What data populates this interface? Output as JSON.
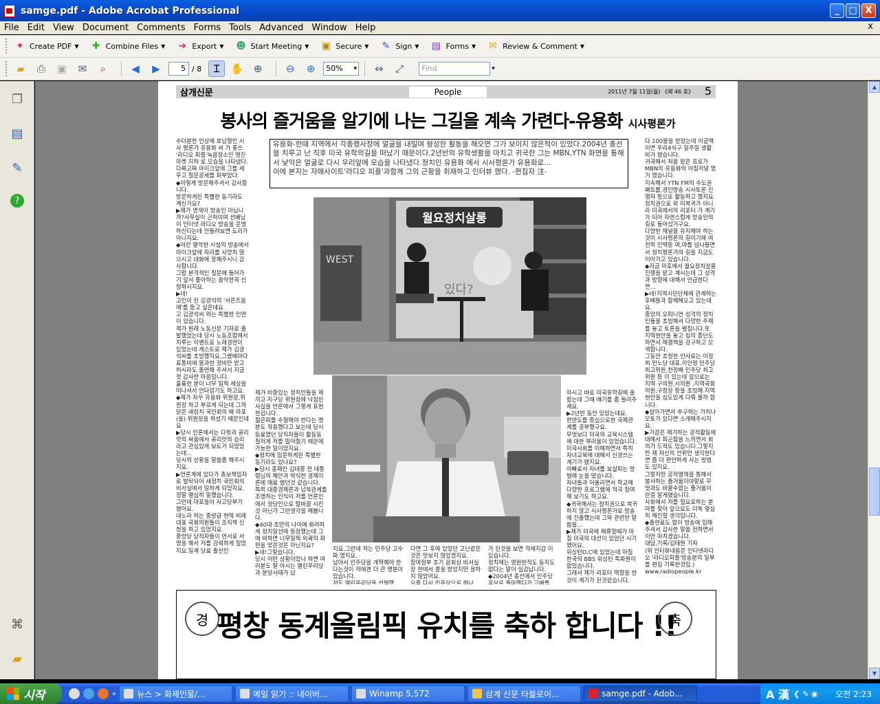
{
  "window": {
    "title": "samge.pdf - Adobe Acrobat Professional",
    "min": "_",
    "max": "□",
    "close": "X"
  },
  "menu": [
    "File",
    "Edit",
    "View",
    "Document",
    "Comments",
    "Forms",
    "Tools",
    "Advanced",
    "Window",
    "Help"
  ],
  "menu_close": "x",
  "toolbar1": [
    {
      "label": "Create PDF",
      "icon": "create-pdf-icon",
      "glyph": "✦",
      "color": "#d33"
    },
    {
      "label": "Combine Files",
      "icon": "combine-files-icon",
      "glyph": "✚",
      "color": "#3a3"
    },
    {
      "label": "Export",
      "icon": "export-icon",
      "glyph": "➜",
      "color": "#c36"
    },
    {
      "label": "Start Meeting",
      "icon": "start-meeting-icon",
      "glyph": "☻",
      "color": "#4a7"
    },
    {
      "label": "Secure",
      "icon": "lock-icon",
      "glyph": "🔒",
      "color": "#b80"
    },
    {
      "label": "Sign",
      "icon": "pen-sign-icon",
      "glyph": "✎",
      "color": "#36c"
    },
    {
      "label": "Forms",
      "icon": "forms-icon",
      "glyph": "▤",
      "color": "#83c"
    },
    {
      "label": "Review & Comment",
      "icon": "review-comment-icon",
      "glyph": "✉",
      "color": "#da2"
    }
  ],
  "nav": {
    "page_current": "5",
    "page_total": "/ 8",
    "zoom": "50%",
    "find_placeholder": "Find"
  },
  "paper": {
    "name": "삼개신문",
    "section": "People",
    "date": "2011년 7월 11일(월) 《제 46 호》",
    "page_no": "5",
    "headline": "봉사의 즐거움을 알기에 나는 그길을 계속 가련다-유용화",
    "headline_sub": "시사평론가",
    "lead": "유용화-한때 지역에서 각종행사장에 얼굴을 내밀며 왕성한 활동을 해오면 그가 보이지 않은적이 있었다.2004년 총선을 치루고 난 직후 미국 유학의길을 떠났기 때문이다.2년반의 유학생활을 마치고 귀국한 그는 MBN,YTN 화면을 통해서 낯익은 얼굴로 다시 우리앞에 모습을 나타냈다.정치인 유용화 에서 시사평론가 유용화로...",
    "lead2": "이에 본지는 자매사이트'라디오 피플'과함께 그의 근황을 취재하고 인터뷰 했다.          -편집자 注-",
    "col1": "수더분한 인상에 호남형인 시사 평론가 유용화 씨 가 롯쓰 '라디오 피플'녹음장소인 영진마켓 지하 로 모습을 나타냈다.\n다짜고짜 마이크앞에 그를 세우고 질문공세를 퍼부었다.\n◆이렇게 방문해주셔서 감사합니다.\n방문하게된 특별한 동기라도 계신가요?\n▶제가 명색이 방송인 아닙니까?사무실이 근처이며 선배님이 인터넷 라디오 방송을 운영하신다는데 안들려보면 도리가 아니지요.\n◆이런 열악한 시설의 방송에서 마이크앞에 자리를 사양치 않으시고 대화에 응해주시니 감사합니다.\n그럼 본격적인 질문에 들어가기 앞서 좋아하는 음악한곡 신청하시지요.\n▶네!\n고인이 된 김광석의 '서른즈음에'를 듣고 싶은데요.\n고 김광석씨 와는 특별한 인연이 있습니다.\n제가 원래 노동신문 기자로 출발했었는데 당시 노동조합에서 치루는 이벤트로 노래경연이 있었는데 게스트로 제가 김광석씨를 초빙했지요.그랬때마다 표통비에 불과한 경비만 받고 허시라도 출연해 주셔서 지금껏 감사한 마음입니다.\n훌륭한 분이 너무 일찍 세상을 떠나셔서 안타깝기도 하고요.\n◆제가 자꾸 유용화 위원장,위원장 하고 부르게 되는데 그까닭은 새정치 국민회의 때 마포(을) 위원장을 하셨기 때문인데요\n▶당시 인론에서는 다윗과 골리앗의 싸움에서 골리앗의 승리라고 관심있게 보도가 되었었는데...\n당시의 상황을 말씀좀 해주시지요.\n▶언론계에 있다가 총보책임자로 발탁되어 새정치 국민회의 비서실에서 일하게 되었지요.\n정말 열심히 일했습니다.\n그런데 마포을이 사고당부가 됐어요.\n내노라 하는 중량급 현역 비례대표 국회의원들이 조직책 신청을 하고 있었지요.\n중앙당 당직자들이 연서로 서명을 해서 저를 강력하게 밀었지요.일계 당료 출신인",
    "col2": "제가 비중있는 정치인들을 제끼고 지구당 위원장에 낙점된 사실을 언론에서 그렇게 표현 한겁니다.\n젊은피를 수혈해야 한다는 명분도 작용했다고 보는데 당시 동료였던 당직자들이 활동동 철저게 저를 밀어줬기 때문에 가능한 일이었지요.\n◆정치에 입문하게된 특별한 동기라도 있나요?\n▶당시 총재인 김대중 전 대통령님의 혜안과 박식한 경제이론에 매료 됐던것 같습니다.\n특히 대중경제론과 남북관계를 조명하는 인식이 저를 언론인에서 정당인으로 탈바꿈 시킨것 아닌가 그런생각을 해봅니다.\n◆40대 초반의 나이에 화려하게 정치일선에 등장했는데 그에 비하면 너무일찍 외곽의 파편을 맞은것은 아닌지요?\n▶네!그렇습니다.\n당시 어떤 상황이었나 하면 여러분도 잘 아시는 열린우리당과 분당사태가 났",
    "col3": "지요.그런데 저는 민주당 고수파 였지요.\n남아서 민주당을 개혁해야 한다는것이 저에겐 더 큰 명분이었습니다.\n저도 열린우리당을 선택했",
    "col4": "다면 그 후에 있었던 고난같은것은 맛보지 않았겠지요.\n참여정부 초기 윤회상 비서실장 한테서 콜을 받았지만 응하지 않았어요.\n요즘 다시 민주당으로 하나",
    "col5": "가 된것을 보면 격세지감 이 있습니다.\n정치에는 영원한적도 동지도 없다는 말이 실감납니다.\n◆2004년 총선에서 민주당 후보로 출마했다가 고배를",
    "col6": "마시고 바로 미국유학길에 올랐는데 그때 얘기를 좀 들려주세요.\n▶2년반 동안 있었는데요.\n한반도를 중심으로한 국제관계를 공부했구요.\n무엇보다 미국의 교육시스템에 대한 부러움이 있었습니다.\n미국사회를 이해하면서 특히 자녀교육에 대해서 신경쓰는 계기가 됐지요.\n아빠로서 자녀를 보살피는 방법에 눈을 떴습니다.\n자녀들과 어울리면서 학교에 다양한 프로그램에 적극 참여해 보기도 하고요.\n◆귀국해서는 정치권으로 복귀하지 않고 시사평론가로 방송에 진출했는데 그와 관련한 말씀을...\n▶제가 미국에 체류할때가 마침 미국의 대선이 있었던 시기였어요.\n워싱턴D.C에 있었는데 마침 한국의 BBS 워싱턴 특파원이 없었습니다.\n그래서 제가 리포터 역할을 한것이 계기가 된것같습니다.",
    "col7": "다.100불을 받았는데 이금액이면 우리4식구 일주일 생활비가 됐습니다.\n귀국해서 처음 맡은 프로가 MBN의 유용화의 아침저널 였거 였습니다.\n지속해서 YTN FM의 수도권 패트롤,경인방송 시사토론 진행자 등으로 활동하고 했지요.\n정치권으로 외 미복귀가 아니라 미국에서의 리포터 가 계기가 되어 자연스럽게 방송인의 길로 들어섰거구요.\n다양한 채널을 유지해야 하는것이 시사평론의 길이기에 여전히 인맥등 여,야를 넘나들면서 정치평론가의 길을 지금도 이어가고 있습니다.\n◆지금 마포에서 월요정치살롱 진행을 맡고 계시는데 그 성격과 방향에 대해서 언급한다면...\n▶네!지역시민단체에 관계하는 후배들과 함께해오고 있는데요.\n중앙의 오피니언 성격의 정치인들을 초빙해서 다양한 주제를 놓고 토론을 펼칩니다.또 지역현안을 놓고 집의 중단도 하면서 해결책을 강구하고 모색합니다.\n그동안 초청한 인사로는 이정희 민노당 대표,이인영 민주당 최고위원,천정배 민주당 최고위원 등 이 있는데 앞으로는 지역 구의원,시의원 ,지역국회의원,구청장 등을 초빙해 지역현안을 심도있게 다뤄 볼까 합니다.\n◆살아가면서 추구하는 가치나 모토가 있다면 소개해주시지요.\n▶가끔은 제가하는 공적활동에 대해서 피곤함을 느끼면서 회의가 드적도 있습니다.그렇지만 제 자신의 안위만 생각한다면 좀 더 편안하게 사는 방법도 있지요.\n그렇지만 공적영역을 통해서 봉사하는 즐거움이야말로 무엇과도 바꿀수없는 즐거움이란걸 알게됐습니다.\n사회에서 저를 필요로하는 분야를 찾아 앞으로도 더욱 열심히 매진할 생각입니다.\n◆출연료도 없이 방송에 임해주셔서 감사한 말씀 전하면서 이만 마치겠습니다.\n대담,기록/김태원 기자\n(위 인터뷰내용은 인터넷라디오 '라디오피플'방송분의 일부를 편집 기록한것임.)\nwww.radiopeople.kr",
    "photo1_banner": "월요정치살롱",
    "photo1_side": "WEST",
    "photo1_text": "있다?",
    "banner": "평창 동계올림픽 유치를 축하 합니다 !!",
    "seal_left": "경",
    "seal_right": "축"
  },
  "taskbar": {
    "start": "시작",
    "tasks": [
      "뉴스 > 화제인물/...",
      "메일 읽기 :: 네이버...",
      "Winamp 5,572",
      "삼계 신문 타블로이...",
      "samge.pdf - Adob..."
    ],
    "ime": "A 漢",
    "clock": "오전 2:23"
  }
}
